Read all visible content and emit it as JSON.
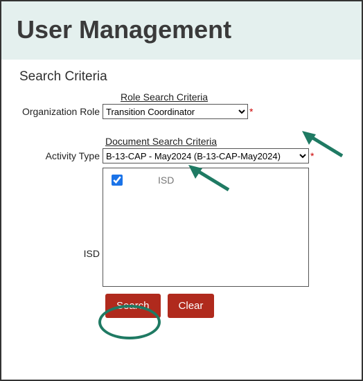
{
  "header": {
    "title": "User Management"
  },
  "section_title": "Search Criteria",
  "role_group_title": "Role Search Criteria",
  "org_role_label": "Organization Role",
  "org_role_value": "Transition Coordinator",
  "doc_group_title": "Document Search Criteria",
  "activity_type_label": "Activity Type",
  "activity_type_value": "B-13-CAP - May2024 (B-13-CAP-May2024)",
  "isd_label": "ISD",
  "isd_list": {
    "item0": {
      "label": "ISD",
      "checked": true
    }
  },
  "buttons": {
    "search": "Search",
    "clear": "Clear"
  },
  "required_mark": "*"
}
